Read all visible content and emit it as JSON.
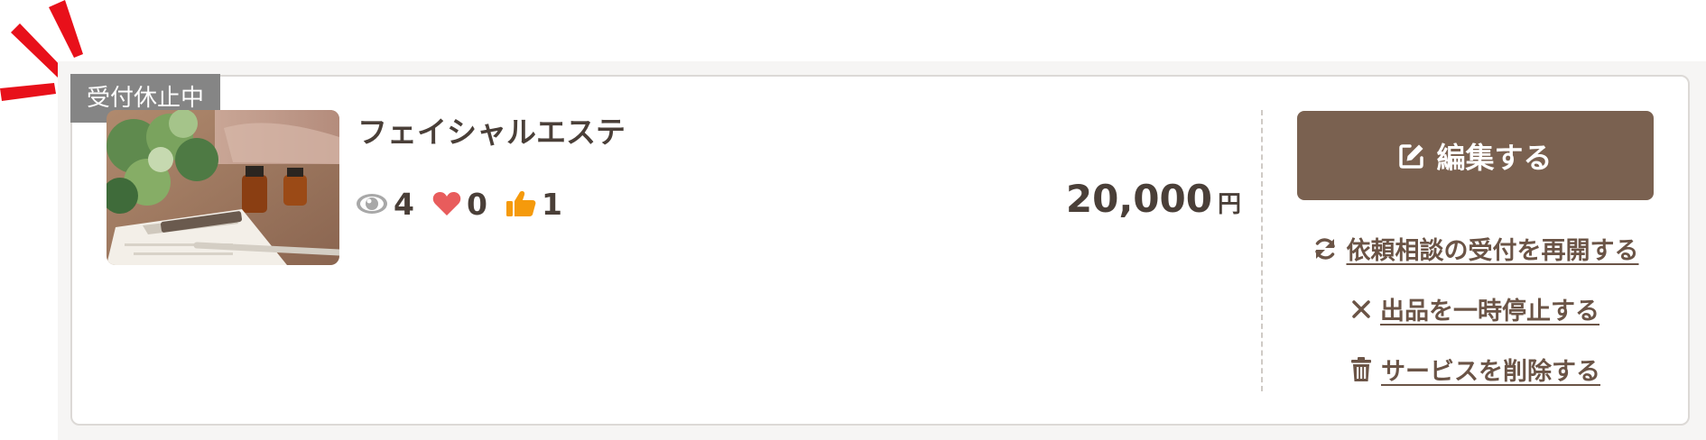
{
  "listing": {
    "status_badge": "受付休止中",
    "title": "フェイシャルエステ",
    "stats": {
      "views": "4",
      "favorites": "0",
      "likes": "1"
    },
    "price": {
      "value": "20,000",
      "unit": "円"
    },
    "thumbnail_icon": "spa-photo-image"
  },
  "actions": {
    "edit_label": "編集する",
    "resume_label": "依頼相談の受付を再開する",
    "pause_label": "出品を一時停止する",
    "delete_label": "サービスを削除する"
  },
  "icons": {
    "views": "eye-icon",
    "favorites": "heart-icon",
    "likes": "thumbs-up-icon",
    "edit": "edit-icon",
    "resume": "refresh-icon",
    "pause": "close-icon",
    "delete": "trash-icon"
  },
  "colors": {
    "brand_brown": "#7a6150",
    "link_brown": "#6b5446",
    "text_dark": "#4a3f38",
    "badge_gray": "#858585",
    "heart_red": "#e85c5c",
    "thumb_orange": "#f59a0c",
    "burst_red": "#e8101a"
  }
}
